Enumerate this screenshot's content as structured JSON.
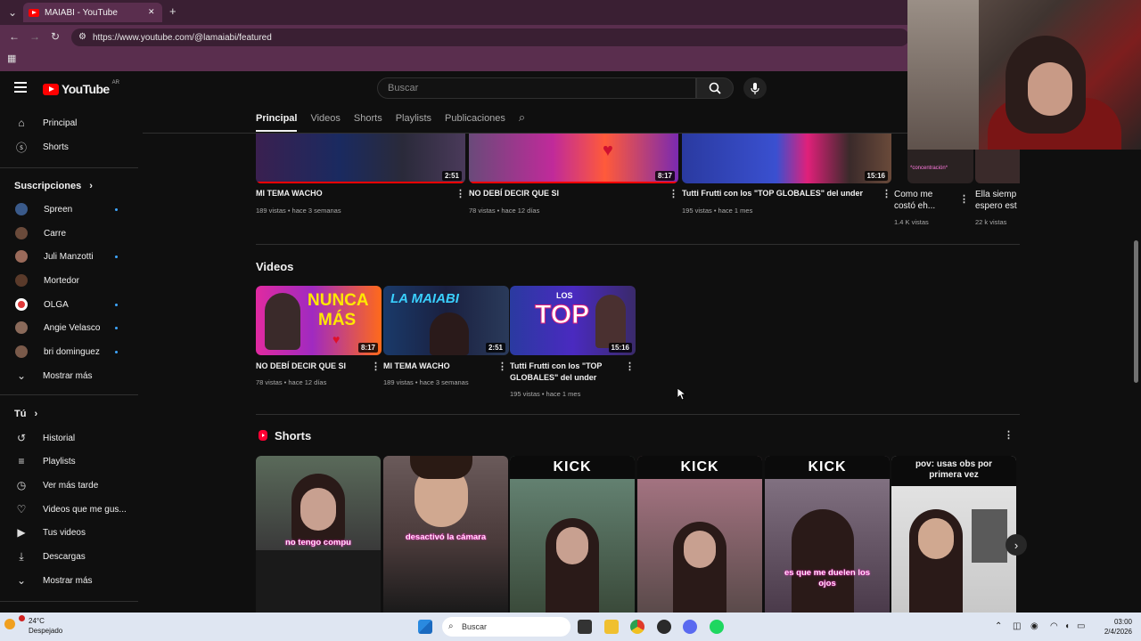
{
  "browser": {
    "tab_title": "MAIABI - YouTube",
    "tab_close": "✕",
    "new_tab": "+",
    "url": "https://www.youtube.com/@lamaiabi/featured"
  },
  "header": {
    "logo_text": "YouTube",
    "country": "AR",
    "search_placeholder": "Buscar"
  },
  "channel_tabs": [
    "Principal",
    "Videos",
    "Shorts",
    "Playlists",
    "Publicaciones"
  ],
  "sidebar": {
    "top": [
      {
        "label": "Principal",
        "icon": "home-icon"
      },
      {
        "label": "Shorts",
        "icon": "shorts-icon"
      }
    ],
    "subscriptions_title": "Suscripciones",
    "subscriptions": [
      {
        "label": "Spreen",
        "color": "#3a5a8a",
        "dot": true
      },
      {
        "label": "Carre",
        "color": "#6a4a3a",
        "dot": false
      },
      {
        "label": "Juli Manzotti",
        "color": "#9a6a5a",
        "dot": true
      },
      {
        "label": "Mortedor",
        "color": "#5a3a2a",
        "dot": false
      },
      {
        "label": "OLGA",
        "color": "#e03a3a",
        "dot": true
      },
      {
        "label": "Angie Velasco",
        "color": "#8a6a5a",
        "dot": true
      },
      {
        "label": "bri dominguez",
        "color": "#7a5a4a",
        "dot": true
      }
    ],
    "show_more_1": "Mostrar más",
    "you_title": "Tú",
    "you_items": [
      {
        "label": "Historial",
        "icon": "history-icon"
      },
      {
        "label": "Playlists",
        "icon": "playlists-icon"
      },
      {
        "label": "Ver más tarde",
        "icon": "watch-later-icon"
      },
      {
        "label": "Videos que me gus...",
        "icon": "like-icon"
      },
      {
        "label": "Tus videos",
        "icon": "your-videos-icon"
      },
      {
        "label": "Descargas",
        "icon": "downloads-icon"
      }
    ],
    "show_more_2": "Mostrar más"
  },
  "top_row": [
    {
      "title": "MI TEMA WACHO",
      "meta": "189 vistas • hace 3 semanas",
      "duration": "2:51"
    },
    {
      "title": "NO DEBÍ DECIR QUE SI",
      "meta": "78 vistas • hace 12 días",
      "duration": "8:17"
    },
    {
      "title": "Tutti Frutti con los \"TOP GLOBALES\" del under",
      "meta": "195 vistas • hace 1 mes",
      "duration": "15:16"
    },
    {
      "title": "Como me costó eh...",
      "meta": "1.4 K vistas"
    },
    {
      "title": "Ella siemp espero est",
      "meta": "22 k vistas"
    }
  ],
  "top_row_extra": {
    "overlay_text": "*concentración*"
  },
  "videos_section": {
    "title": "Videos",
    "items": [
      {
        "title": "NO DEBÍ DECIR QUE SI",
        "meta": "78 vistas • hace 12 días",
        "duration": "8:17",
        "thumb_text_1": "NUNCA",
        "thumb_text_2": "MÁS"
      },
      {
        "title": "MI TEMA WACHO",
        "meta": "189 vistas • hace 3 semanas",
        "duration": "2:51",
        "thumb_text_1": "LA MAIABI"
      },
      {
        "title": "Tutti Frutti con los \"TOP GLOBALES\" del under",
        "meta": "195 vistas • hace 1 mes",
        "duration": "15:16",
        "thumb_text_1": "LOS",
        "thumb_text_2": "TOP"
      }
    ]
  },
  "shorts_section": {
    "title": "Shorts",
    "items": [
      {
        "caption": "no tengo compu"
      },
      {
        "caption": "desactivó la cámara"
      },
      {
        "banner": "KICK"
      },
      {
        "banner": "KICK"
      },
      {
        "banner": "KICK",
        "caption": "es que me duelen los ojos"
      },
      {
        "banner": "pov: usas obs por primera vez"
      }
    ]
  },
  "taskbar": {
    "temp": "24°C",
    "weather": "Despejado",
    "search": "Buscar",
    "time": "03:00",
    "date": "2/4/2026"
  },
  "colors": {
    "brand_red": "#ff0000",
    "background": "#0f0f0f",
    "browser_frame": "#5a2e4e"
  }
}
